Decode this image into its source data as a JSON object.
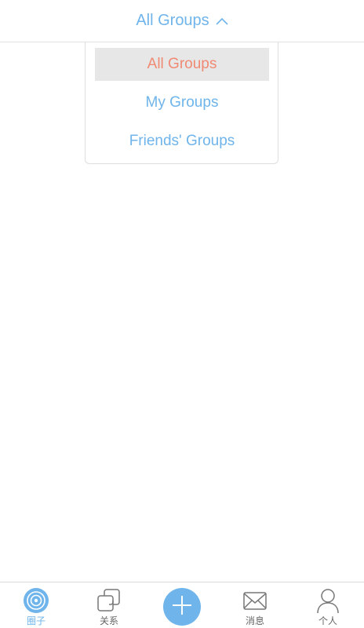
{
  "header": {
    "title": "All Groups",
    "chevron_icon": "chevron-up-icon"
  },
  "dropdown": {
    "items": [
      {
        "label": "All Groups",
        "selected": true
      },
      {
        "label": "My Groups",
        "selected": false
      },
      {
        "label": "Friends' Groups",
        "selected": false
      }
    ]
  },
  "tabbar": {
    "tabs": [
      {
        "label": "圈子",
        "icon": "target-circle-icon",
        "active": true
      },
      {
        "label": "关系",
        "icon": "overlapping-squares-icon",
        "active": false
      },
      {
        "label": "",
        "icon": "plus-icon",
        "active": false
      },
      {
        "label": "消息",
        "icon": "envelope-icon",
        "active": false
      },
      {
        "label": "个人",
        "icon": "person-icon",
        "active": false
      }
    ]
  },
  "colors": {
    "accent": "#6fb4ea",
    "selected_text": "#f08a73",
    "selected_bg": "#e7e7e7",
    "tab_label": "#666666"
  }
}
